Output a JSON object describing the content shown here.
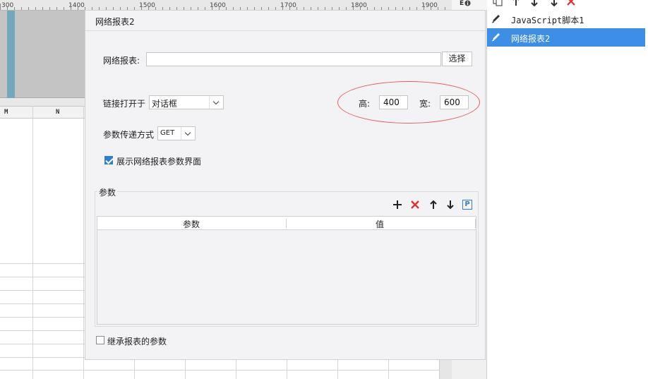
{
  "sheet": {
    "ruler_labels": [
      "300",
      "1400",
      "1500",
      "1600",
      "1700",
      "1800",
      "1900"
    ],
    "columns": [
      "M",
      "N"
    ]
  },
  "separator": {
    "icon_text": "E"
  },
  "right_panel": {
    "toolbar_icons": [
      "copy-icon",
      "arrow-up-icon",
      "arrow-down-icon",
      "move-down-icon",
      "close-icon"
    ],
    "items": [
      {
        "label": "JavaScript脚本1",
        "selected": false
      },
      {
        "label": "网络报表2",
        "selected": true
      }
    ]
  },
  "dialog": {
    "title": "网络报表2",
    "report_label": "网络报表:",
    "report_value": "",
    "select_button": "选择",
    "open_in_label": "链接打开于",
    "open_in_value": "对话框",
    "height_label": "高:",
    "height_value": "400",
    "width_label": "宽:",
    "width_value": "600",
    "method_label": "参数传递方式",
    "method_value": "GET",
    "show_params_label": "展示网络报表参数界面",
    "show_params_checked": true,
    "params_group_label": "参数",
    "params_columns": [
      "参数",
      "值"
    ],
    "inherit_label": "继承报表的参数",
    "inherit_checked": false,
    "param_tool_p": "P"
  },
  "colors": {
    "selection": "#3c8ee6",
    "delete_red": "#e03030",
    "highlight_ellipse": "#e06060",
    "checkbox_blue": "#2f7fd0"
  }
}
